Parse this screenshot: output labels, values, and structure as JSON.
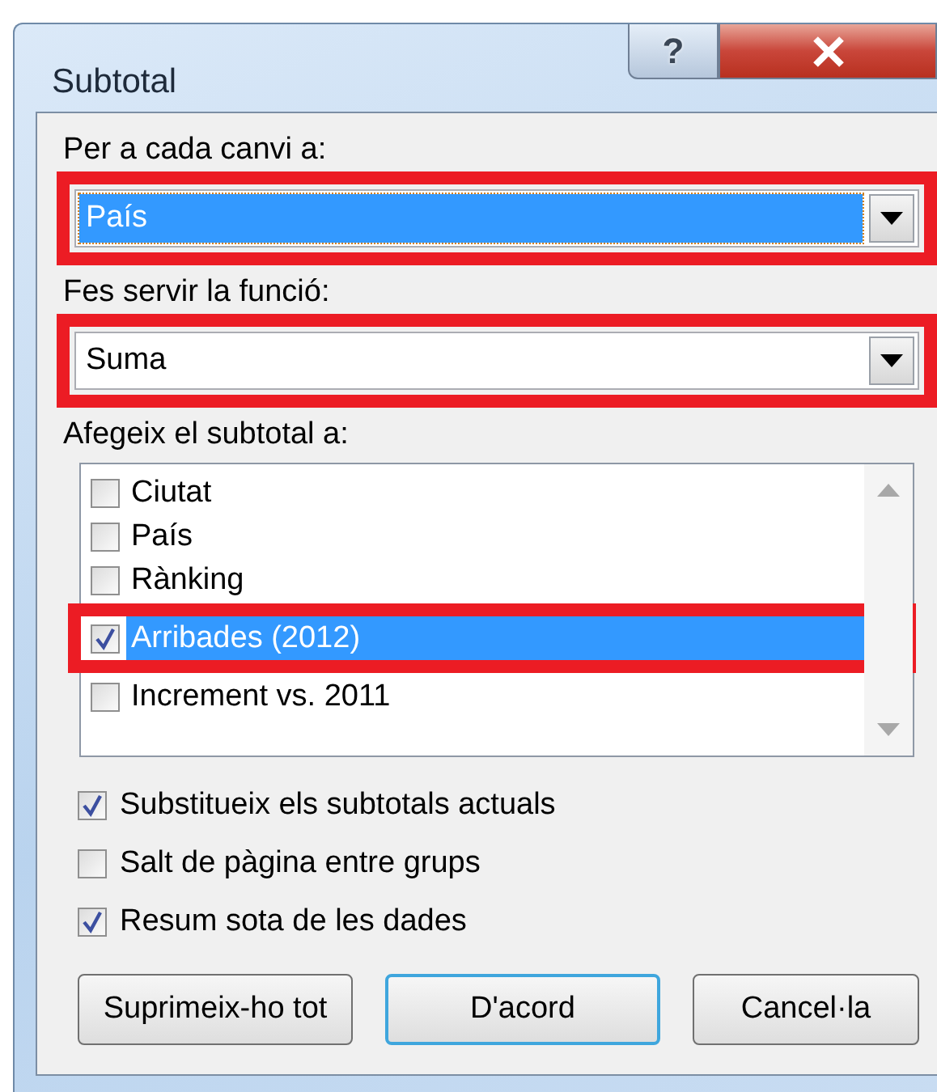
{
  "window": {
    "title": "Subtotal",
    "controls": [
      {
        "kind": "help",
        "label": "?"
      },
      {
        "kind": "close"
      }
    ]
  },
  "combos": [
    {
      "label": "Per a cada canvi a:",
      "value": "País",
      "focused": true,
      "annotated": true
    },
    {
      "label": "Fes servir la funció:",
      "value": "Suma",
      "focused": false,
      "annotated": true
    }
  ],
  "list": {
    "label": "Afegeix el subtotal a:",
    "items": [
      {
        "label": "Ciutat",
        "checked": false,
        "selected": false,
        "annotated": false
      },
      {
        "label": "País",
        "checked": false,
        "selected": false,
        "annotated": false
      },
      {
        "label": "Rànking",
        "checked": false,
        "selected": false,
        "annotated": false
      },
      {
        "label": "Arribades (2012)",
        "checked": true,
        "selected": true,
        "annotated": true
      },
      {
        "label": "Increment vs. 2011",
        "checked": false,
        "selected": false,
        "annotated": false
      }
    ]
  },
  "options": [
    {
      "label": "Substitueix els subtotals actuals",
      "checked": true
    },
    {
      "label": "Salt de pàgina entre grups",
      "checked": false
    },
    {
      "label": "Resum sota de les dades",
      "checked": true
    }
  ],
  "buttons": [
    {
      "label": "Suprimeix-ho tot",
      "default": false
    },
    {
      "label": "D'acord",
      "default": true
    },
    {
      "label": "Cancel·la",
      "default": false
    }
  ]
}
